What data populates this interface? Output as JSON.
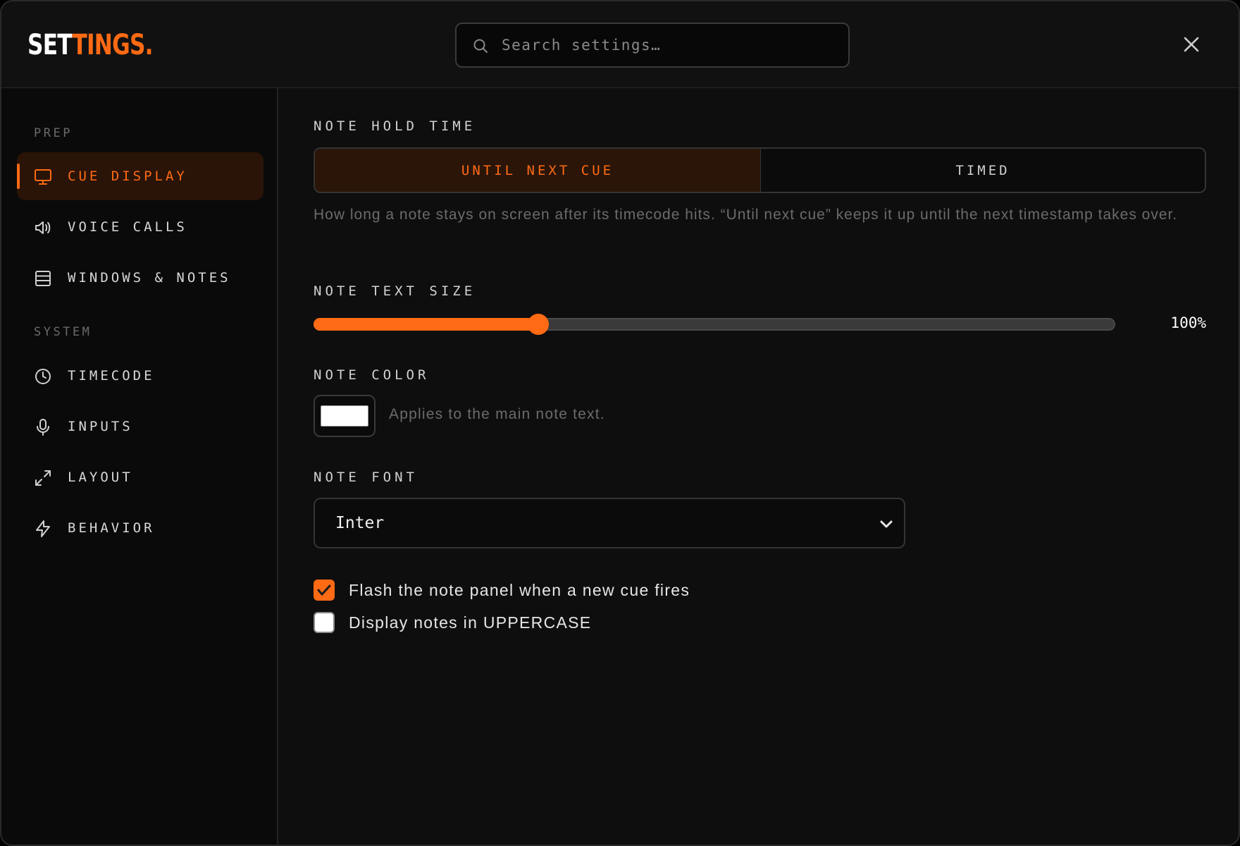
{
  "app": {
    "logo_white": "SET",
    "logo_orange": "TINGS."
  },
  "search": {
    "placeholder": "Search settings…",
    "value": ""
  },
  "sidebar": {
    "sections": [
      {
        "label": "PREP",
        "items": [
          {
            "label": "CUE DISPLAY",
            "icon": "monitor-icon",
            "active": true
          },
          {
            "label": "VOICE CALLS",
            "icon": "speaker-icon",
            "active": false
          },
          {
            "label": "WINDOWS & NOTES",
            "icon": "layers-icon",
            "active": false
          }
        ]
      },
      {
        "label": "SYSTEM",
        "items": [
          {
            "label": "TIMECODE",
            "icon": "clock-icon",
            "active": false
          },
          {
            "label": "INPUTS",
            "icon": "microphone-icon",
            "active": false
          },
          {
            "label": "LAYOUT",
            "icon": "expand-icon",
            "active": false
          },
          {
            "label": "BEHAVIOR",
            "icon": "lightning-icon",
            "active": false
          }
        ]
      }
    ]
  },
  "main": {
    "hold_time": {
      "label": "NOTE HOLD TIME",
      "options": [
        "UNTIL NEXT CUE",
        "TIMED"
      ],
      "selected": "UNTIL NEXT CUE",
      "help": "How long a note stays on screen after its timecode hits. “Until next cue” keeps it up until the next timestamp takes over."
    },
    "text_size": {
      "label": "NOTE TEXT SIZE",
      "value_text": "100%",
      "slider_fraction": 0.28
    },
    "color": {
      "label": "NOTE COLOR",
      "value": "#ffffff",
      "hint": "Applies to the main note text."
    },
    "font": {
      "label": "NOTE FONT",
      "value": "Inter"
    },
    "checkboxes": [
      {
        "label": "Flash the note panel when a new cue fires",
        "checked": true
      },
      {
        "label": "Display notes in UPPERCASE",
        "checked": false
      }
    ]
  },
  "colors": {
    "accent": "#ff6a14",
    "background": "#0e0e0e",
    "sidebar": "#0a0a0a"
  }
}
